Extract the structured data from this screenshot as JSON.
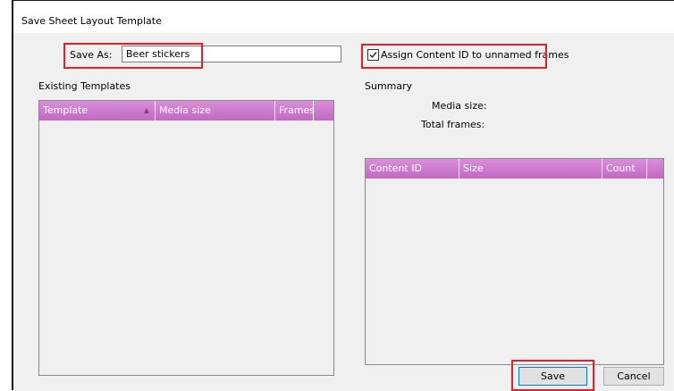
{
  "window": {
    "title": "Save Sheet Layout Template"
  },
  "save_as": {
    "label": "Save As:",
    "value": "Beer stickers"
  },
  "assign_content_id": {
    "label": "Assign Content ID to unnamed frames",
    "checked": true
  },
  "existing_templates": {
    "heading": "Existing Templates",
    "columns": [
      "Template",
      "Media size",
      "Frames"
    ],
    "sort_column": "Template",
    "rows": []
  },
  "summary": {
    "heading": "Summary",
    "media_size_label": "Media size:",
    "total_frames_label": "Total frames:",
    "columns": [
      "Content ID",
      "Size",
      "Count"
    ],
    "rows": []
  },
  "buttons": {
    "save": "Save",
    "cancel": "Cancel"
  },
  "colors": {
    "header_gradient_top": "#d98fd9",
    "header_gradient_bottom": "#c168c4",
    "highlight": "#e0202a"
  }
}
